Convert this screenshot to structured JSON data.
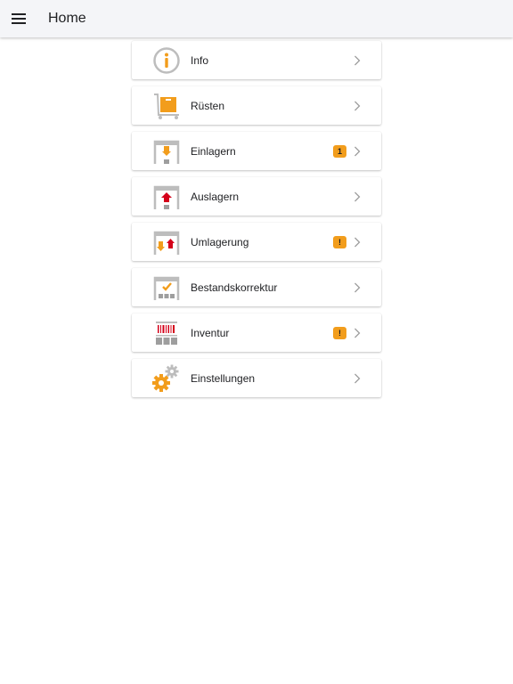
{
  "app_bar": {
    "title": "Home",
    "menu_icon": "hamburger-menu-icon"
  },
  "colors": {
    "accent_orange": "#f29d1c",
    "accent_red": "#d4001a",
    "icon_gray": "#9e9e9e",
    "app_bar_bg": "#f4f5f8"
  },
  "menu": {
    "items": [
      {
        "label": "Info",
        "icon": "info-icon",
        "badge": null
      },
      {
        "label": "Rüsten",
        "icon": "cart-box-icon",
        "badge": null
      },
      {
        "label": "Einlagern",
        "icon": "store-in-icon",
        "badge": "1"
      },
      {
        "label": "Auslagern",
        "icon": "store-out-icon",
        "badge": null
      },
      {
        "label": "Umlagerung",
        "icon": "relocate-icon",
        "badge": "!"
      },
      {
        "label": "Bestandskorrektur",
        "icon": "stock-correction-icon",
        "badge": null
      },
      {
        "label": "Inventur",
        "icon": "inventory-icon",
        "badge": "!"
      },
      {
        "label": "Einstellungen",
        "icon": "settings-gears-icon",
        "badge": null
      }
    ]
  }
}
